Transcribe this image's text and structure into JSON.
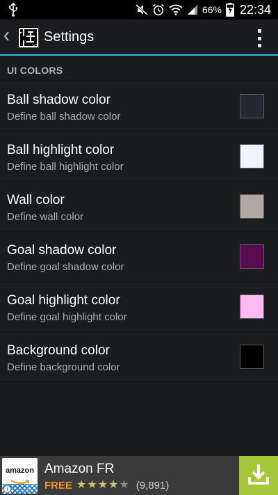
{
  "status_bar": {
    "battery_percent": "66%",
    "time": "22:34",
    "icons": [
      "usb-icon",
      "mute-icon",
      "alarm-icon",
      "wifi-icon",
      "signal-icon",
      "battery-charging-icon"
    ]
  },
  "action_bar": {
    "title": "Settings",
    "app_icon": "maze-app-icon"
  },
  "category": {
    "title": "UI COLORS"
  },
  "preferences": [
    {
      "title": "Ball shadow color",
      "summary": "Define ball shadow color",
      "color": "#262532"
    },
    {
      "title": "Ball highlight color",
      "summary": "Define ball highlight color",
      "color": "#f2f1fe"
    },
    {
      "title": "Wall color",
      "summary": "Define wall color",
      "color": "#b1a8a5"
    },
    {
      "title": "Goal shadow color",
      "summary": "Define goal shadow color",
      "color": "#5a0c52"
    },
    {
      "title": "Goal highlight color",
      "summary": "Define goal highlight color",
      "color": "#febaee"
    },
    {
      "title": "Background color",
      "summary": "Define background color",
      "color": "#000000"
    }
  ],
  "ad": {
    "logo_text": "amazon",
    "name": "Amazon FR",
    "price": "FREE",
    "rating_stars": 4,
    "rating_max": 5,
    "rating_count": "(9,891)"
  },
  "colors": {
    "accent": "#33b5e5",
    "install_button": "#a4c639",
    "price": "#f7941d"
  }
}
